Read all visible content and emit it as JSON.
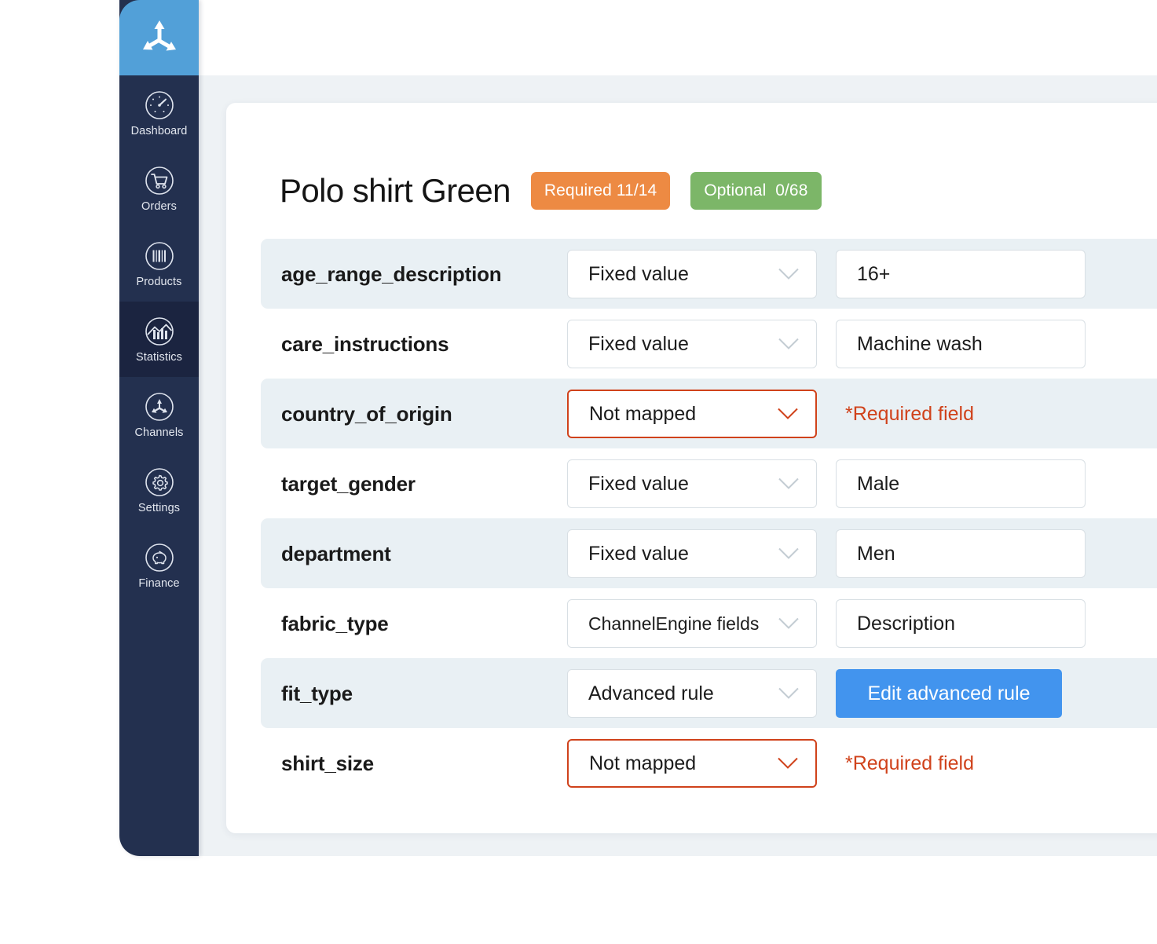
{
  "sidebar": {
    "logo": {
      "name": "channelengine-logo"
    },
    "items": [
      {
        "label": "Dashboard",
        "icon": "gauge-icon",
        "active": false
      },
      {
        "label": "Orders",
        "icon": "shopping-cart-icon",
        "active": false
      },
      {
        "label": "Products",
        "icon": "barcode-icon",
        "active": false
      },
      {
        "label": "Statistics",
        "icon": "bar-chart-icon",
        "active": true
      },
      {
        "label": "Channels",
        "icon": "channels-icon",
        "active": false
      },
      {
        "label": "Settings",
        "icon": "gear-icon",
        "active": false
      },
      {
        "label": "Finance",
        "icon": "piggy-bank-icon",
        "active": false
      }
    ]
  },
  "header": {
    "title": "Polo shirt Green",
    "badges": [
      {
        "label": "Required 11/14",
        "color": "#ed8a43",
        "kind": "required"
      },
      {
        "label": "Optional  0/68",
        "color": "#7cb668",
        "kind": "optional"
      }
    ]
  },
  "colors": {
    "accent_blue": "#4294ee",
    "sidebar": "#23304f",
    "sidebar_active": "#1b2440",
    "logo_blue": "#52a0d8",
    "badge_orange": "#ed8a43",
    "badge_green": "#7cb668",
    "error_red": "#d0421b",
    "row_stripe": "#e9f0f4",
    "page_bg": "#eef2f5"
  },
  "mapping_rows": [
    {
      "field": "age_range_description",
      "mapping_type": "Fixed value",
      "value": "16+",
      "state": "ok",
      "striped": true,
      "control": "value"
    },
    {
      "field": "care_instructions",
      "mapping_type": "Fixed value",
      "value": "Machine wash",
      "state": "ok",
      "striped": false,
      "control": "value"
    },
    {
      "field": "country_of_origin",
      "mapping_type": "Not mapped",
      "value": "*Required field",
      "state": "error",
      "striped": true,
      "control": "message"
    },
    {
      "field": "target_gender",
      "mapping_type": "Fixed value",
      "value": "Male",
      "state": "ok",
      "striped": false,
      "control": "value"
    },
    {
      "field": "department",
      "mapping_type": "Fixed value",
      "value": "Men",
      "state": "ok",
      "striped": true,
      "control": "value"
    },
    {
      "field": "fabric_type",
      "mapping_type": "ChannelEngine fields",
      "value": "Description",
      "state": "ok",
      "striped": false,
      "control": "value"
    },
    {
      "field": "fit_type",
      "mapping_type": "Advanced rule",
      "value": "Edit advanced rule",
      "state": "ok",
      "striped": true,
      "control": "button"
    },
    {
      "field": "shirt_size",
      "mapping_type": "Not mapped",
      "value": "*Required field",
      "state": "error",
      "striped": false,
      "control": "message"
    }
  ]
}
